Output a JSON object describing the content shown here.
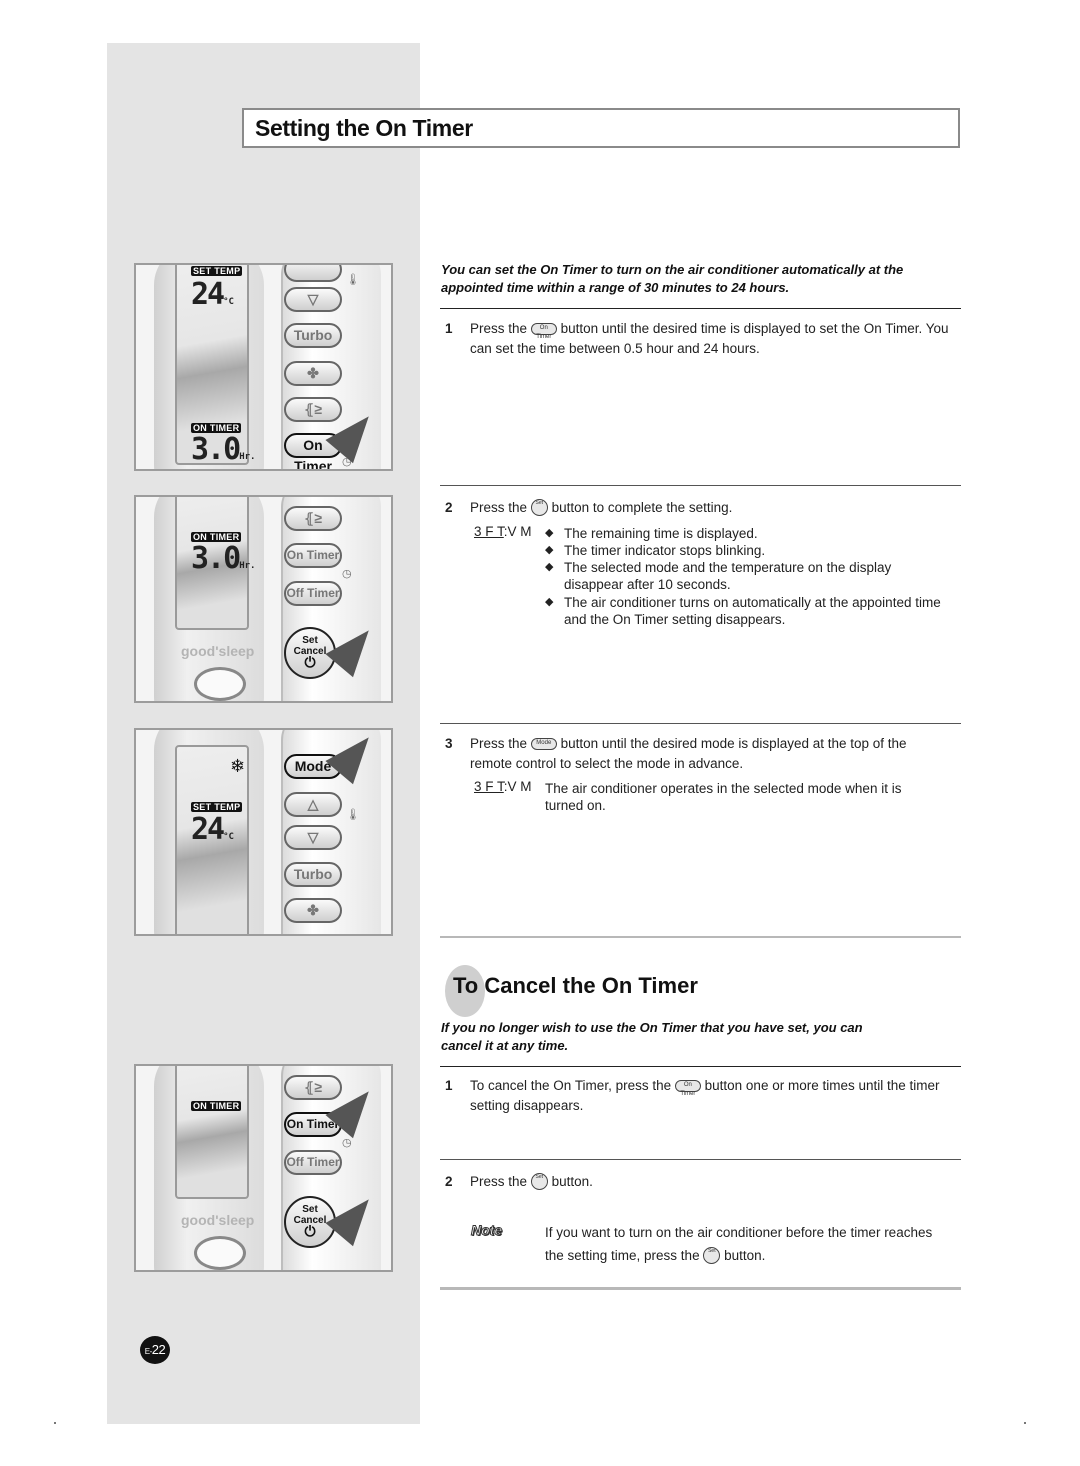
{
  "page": {
    "title": "Setting the On Timer",
    "page_number_prefix": "E-",
    "page_number": "22"
  },
  "section_set": {
    "intro": "You can set the On Timer to turn on the air conditioner automatically at the appointed time within a range of 30 minutes to 24 hours.",
    "steps": [
      {
        "num": "1",
        "before": "Press the",
        "button_icon": "On Timer",
        "after": "button until the desired time is displayed to set the On Timer. You can set the time between 0.5 hour and 24 hours."
      },
      {
        "num": "2",
        "before": "Press the",
        "button_icon": "Set Cancel",
        "after": "button to complete the setting.",
        "result_label": "3 F T",
        "result_suffix": ":V M",
        "bullets": [
          "The remaining time is displayed.",
          "The timer indicator stops blinking.",
          "The selected mode and the temperature on the display disappear after 10 seconds.",
          "The air conditioner turns on automatically at the appointed time and the On Timer setting disappears."
        ]
      },
      {
        "num": "3",
        "before": "Press the",
        "button_icon": "Mode",
        "after": "button until the desired mode is displayed at the top of the remote control to select the mode in advance.",
        "result_label": "3 F T",
        "result_suffix": ":V M",
        "result_text": "The air conditioner operates in the selected mode when it is turned on."
      }
    ]
  },
  "section_cancel": {
    "title": "To Cancel the On Timer",
    "intro": "If you no longer wish to use the On Timer that you have set, you can cancel it at any time.",
    "steps": [
      {
        "num": "1",
        "before": "To cancel the On Timer, press the",
        "button_icon": "On Timer",
        "after": "button one or more times until the timer setting disappears."
      },
      {
        "num": "2",
        "before": "Press the",
        "button_icon": "Set Cancel",
        "after": "button."
      }
    ],
    "note": {
      "label": "Note",
      "before": "If you want to turn on the air conditioner before the timer reaches the setting time, press the",
      "button_icon": "Set Cancel",
      "after": "button."
    }
  },
  "illustrations": [
    {
      "lcd_tags": [
        "SET TEMP",
        "ON TIMER"
      ],
      "lcd_values": [
        "24",
        "3.0"
      ],
      "units": [
        "°C",
        "Hr."
      ],
      "buttons": [
        "▽",
        "Turbo",
        "fan",
        "swing",
        "On Timer"
      ],
      "highlighted": "On Timer"
    },
    {
      "lcd_tags": [
        "ON TIMER"
      ],
      "lcd_values": [
        "3.0"
      ],
      "units": [
        "Hr."
      ],
      "buttons": [
        "swing",
        "On Timer",
        "Off Timer",
        "Set Cancel"
      ],
      "brand": "good'sleep",
      "highlighted": "Set Cancel"
    },
    {
      "lcd_tags": [
        "SET TEMP"
      ],
      "lcd_values": [
        "24"
      ],
      "units": [
        "°C"
      ],
      "mode_icon": "❄",
      "buttons": [
        "Mode",
        "△",
        "▽",
        "Turbo",
        "fan"
      ],
      "highlighted": "Mode"
    },
    {
      "lcd_tags": [
        "ON TIMER"
      ],
      "buttons": [
        "swing",
        "On Timer",
        "Off Timer",
        "Set Cancel"
      ],
      "brand": "good'sleep",
      "highlighted": "On Timer, Set Cancel"
    }
  ],
  "icon_text": {
    "on_timer_small": "On Timer",
    "set_cancel_small": "Set",
    "mode_small": "Mode",
    "power": "⏻",
    "diamond": "◆",
    "clock": "◷",
    "thermo": "🌡",
    "fan": "✤",
    "swing": "⦃≥",
    "up": "△",
    "down": "▽",
    "snow": "❄"
  }
}
